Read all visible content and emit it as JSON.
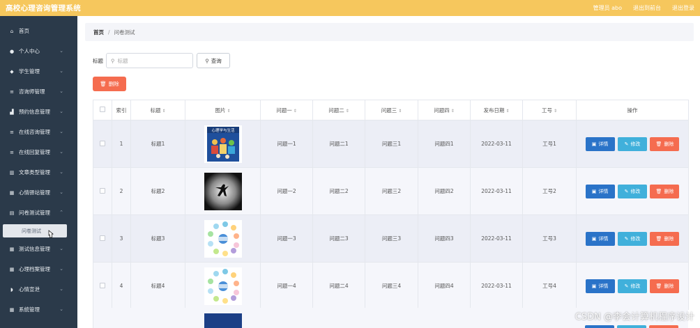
{
  "app": {
    "title": "高校心理咨询管理系统",
    "user_text": "管理员 abo",
    "to_front": "退出到前台",
    "logout": "退出登录"
  },
  "sidebar": {
    "items": [
      {
        "label": "首页",
        "icon": "home-icon",
        "has_children": false
      },
      {
        "label": "个人中心",
        "icon": "user-icon",
        "has_children": true
      },
      {
        "label": "学生管理",
        "icon": "student-icon",
        "has_children": true
      },
      {
        "label": "咨询师管理",
        "icon": "list-icon",
        "has_children": true
      },
      {
        "label": "预约信息管理",
        "icon": "chart-icon",
        "has_children": true
      },
      {
        "label": "在线咨询管理",
        "icon": "list-icon",
        "has_children": true
      },
      {
        "label": "在线回复管理",
        "icon": "list-icon",
        "has_children": true
      },
      {
        "label": "文章类型管理",
        "icon": "bar-chart-icon",
        "has_children": true
      },
      {
        "label": "心情驿站管理",
        "icon": "grid-icon",
        "has_children": true
      },
      {
        "label": "问卷测试管理",
        "icon": "document-icon",
        "has_children": true
      }
    ],
    "active_sub": "问卷测试",
    "items_after": [
      {
        "label": "测试信息管理",
        "icon": "grid-icon",
        "has_children": true
      },
      {
        "label": "心理档案管理",
        "icon": "grid-icon",
        "has_children": true
      },
      {
        "label": "心情宣泄",
        "icon": "mask-icon",
        "has_children": true
      },
      {
        "label": "系统管理",
        "icon": "grid-icon",
        "has_children": true
      }
    ]
  },
  "breadcrumb": {
    "home": "首页",
    "sep": "/",
    "current": "问卷测试"
  },
  "search": {
    "label": "标题",
    "placeholder": "标题",
    "button": "查询"
  },
  "toolbar": {
    "delete": "删除"
  },
  "table": {
    "headers": [
      "索引",
      "标题",
      "图片",
      "问题一",
      "问题二",
      "问题三",
      "问题四",
      "发布日期",
      "工号",
      "操作"
    ],
    "rows": [
      {
        "index": "1",
        "title": "标题1",
        "image": "book-cover-image",
        "q1": "问题一1",
        "q2": "问题二1",
        "q3": "问题三1",
        "q4": "问题四1",
        "date": "2022-03-11",
        "work_no": "工号1"
      },
      {
        "index": "2",
        "title": "标题2",
        "image": "dancer-silhouette-image",
        "q1": "问题一2",
        "q2": "问题二2",
        "q3": "问题三2",
        "q4": "问题四2",
        "date": "2022-03-11",
        "work_no": "工号2"
      },
      {
        "index": "3",
        "title": "标题3",
        "image": "emotion-icons-image",
        "q1": "问题一3",
        "q2": "问题二3",
        "q3": "问题三3",
        "q4": "问题四3",
        "date": "2022-03-11",
        "work_no": "工号3"
      },
      {
        "index": "4",
        "title": "标题4",
        "image": "emotion-icons-image",
        "q1": "问题一4",
        "q2": "问题二4",
        "q3": "问题三4",
        "q4": "问题四4",
        "date": "2022-03-11",
        "work_no": "工号4"
      }
    ],
    "actions": {
      "detail": "详情",
      "edit": "修改",
      "delete": "删除"
    }
  },
  "book_title": "心理学与生活",
  "watermark": "CSDN @李会计算机程序设计",
  "colors": {
    "topbar": "#f6c75d",
    "sidebar": "#2b3a4a",
    "detail": "#2a73c8",
    "edit": "#40b0db",
    "delete": "#f56c4f"
  }
}
